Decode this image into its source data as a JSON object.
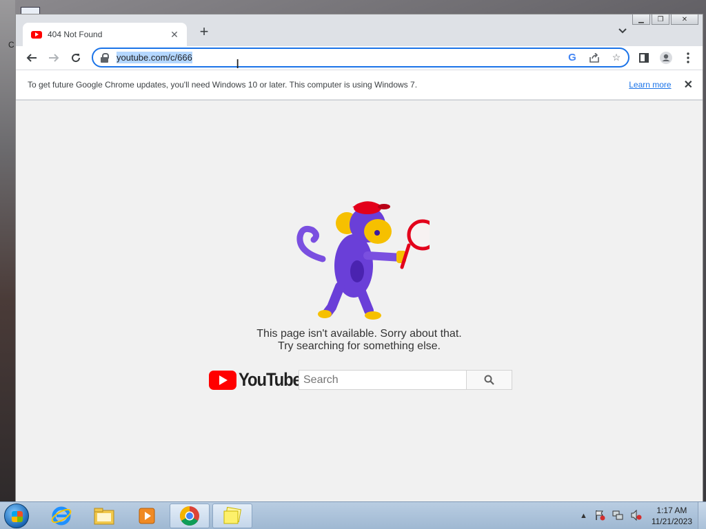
{
  "desktop": {
    "glyph": "C"
  },
  "browser": {
    "tab": {
      "title": "404 Not Found"
    },
    "address": {
      "url": "youtube.com/c/666"
    },
    "infobar": {
      "message": "To get future Google Chrome updates, you'll need Windows 10 or later. This computer is using Windows 7.",
      "link": "Learn more"
    }
  },
  "page": {
    "message_line1": "This page isn't available. Sorry about that.",
    "message_line2": "Try searching for something else.",
    "logo_text": "YouTube",
    "search_placeholder": "Search"
  },
  "taskbar": {
    "apps": [
      "internet-explorer-icon",
      "file-explorer-icon",
      "media-player-icon",
      "chrome-icon",
      "sticky-notes-icon"
    ],
    "clock": {
      "time": "1:17 AM",
      "date": "11/21/2023"
    }
  },
  "colors": {
    "accent": "#1a73e8",
    "youtube_red": "#ff0000",
    "page_bg": "#f1f1f1"
  }
}
